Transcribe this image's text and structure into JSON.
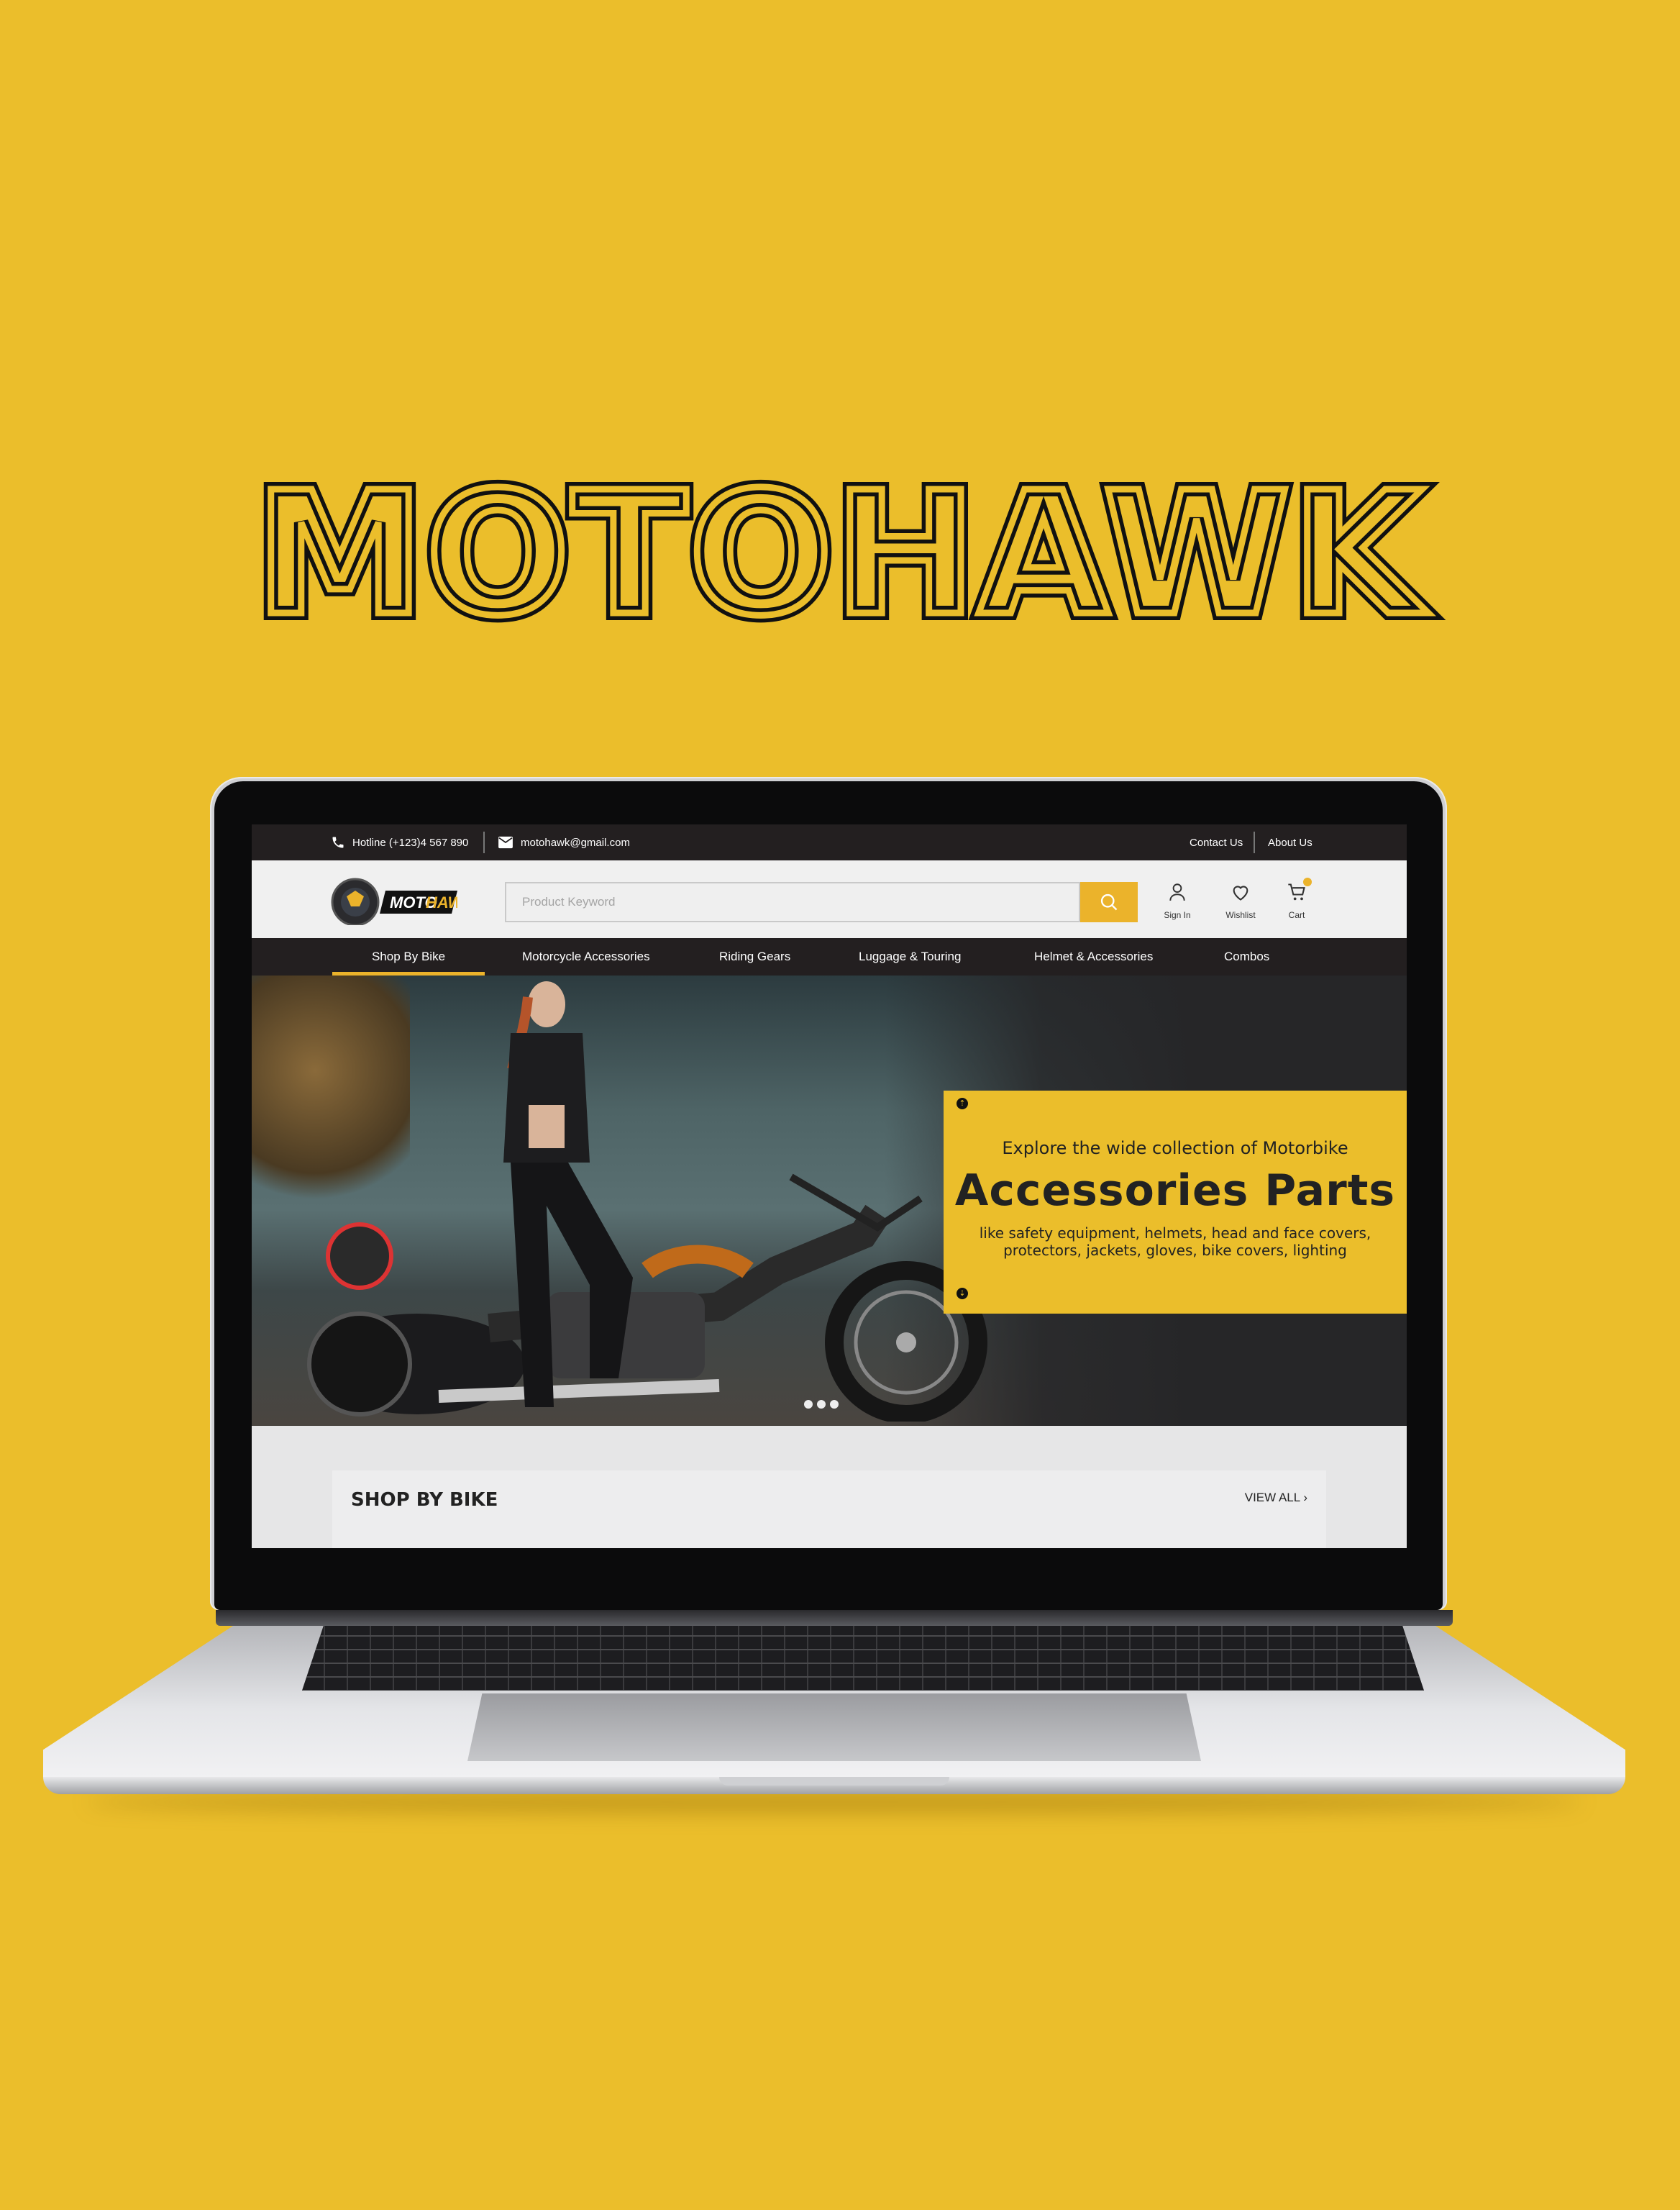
{
  "poster": {
    "title": "MOTOHAWK"
  },
  "colors": {
    "brand_yellow": "#EBBE2B",
    "accent": "#EBB32B",
    "dark": "#231F20"
  },
  "site": {
    "topbar": {
      "hotline": "Hotline (+123)4 567 890",
      "email": "motohawk@gmail.com",
      "contact_us": "Contact Us",
      "about_us": "About Us"
    },
    "header": {
      "logo_text_1": "MOTO",
      "logo_text_2": "HAWK",
      "search_placeholder": "Product Keyword",
      "sign_in": "Sign In",
      "wishlist": "Wishlist",
      "cart": "Cart"
    },
    "nav": {
      "tabs": [
        {
          "label": "Shop By Bike",
          "active": true
        },
        {
          "label": "Motorcycle Accessories"
        },
        {
          "label": "Riding Gears"
        },
        {
          "label": "Luggage & Touring"
        },
        {
          "label": "Helmet & Accessories"
        },
        {
          "label": "Combos"
        }
      ]
    },
    "hero": {
      "line1": "Explore the wide collection of Motorbike",
      "line2": "Accessories Parts",
      "line3a": "like safety equipment, helmets, head and face covers,",
      "line3b": "protectors, jackets, gloves, bike covers, lighting",
      "slides": 3
    },
    "section": {
      "title": "SHOP BY BIKE",
      "view_all": "VIEW ALL"
    }
  }
}
